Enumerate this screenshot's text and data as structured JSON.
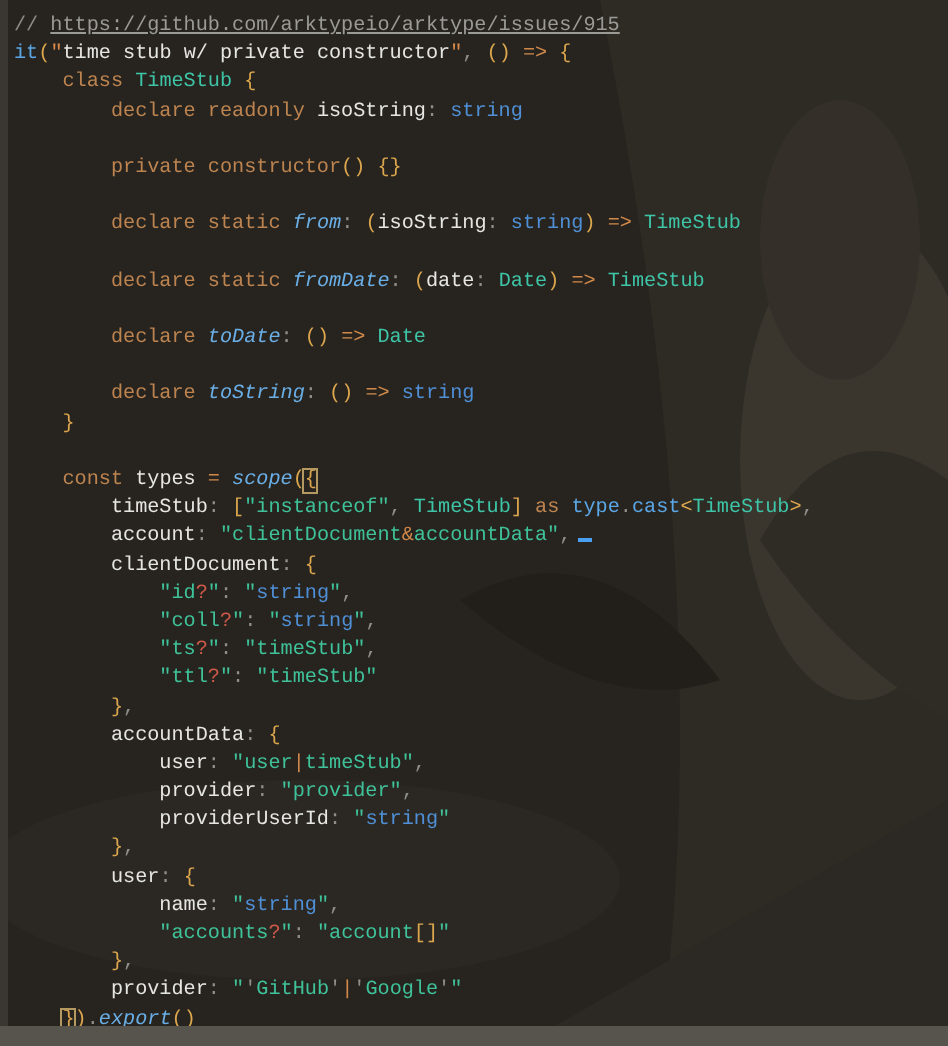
{
  "editor": {
    "lines": [
      {
        "tokens": [
          {
            "kind": "cm",
            "text": "// "
          },
          {
            "kind": "ln",
            "text": "https://github.com/arktypeio/arktype/issues/915"
          }
        ]
      },
      {
        "tokens": [
          {
            "kind": "call",
            "text": "it"
          },
          {
            "kind": "br",
            "text": "("
          },
          {
            "kind": "q",
            "text": "\""
          },
          {
            "kind": "id",
            "text": "time stub w/ private constructor"
          },
          {
            "kind": "q",
            "text": "\""
          },
          {
            "kind": "pu",
            "text": ", "
          },
          {
            "kind": "br",
            "text": "()"
          },
          {
            "kind": "op",
            "text": " => "
          },
          {
            "kind": "br",
            "text": "{"
          }
        ]
      },
      {
        "tokens": [
          {
            "kind": "kw",
            "text": "    class "
          },
          {
            "kind": "ty",
            "text": "TimeStub"
          },
          {
            "kind": "br",
            "text": " {"
          }
        ]
      },
      {
        "tokens": [
          {
            "kind": "kw",
            "text": "        declare readonly "
          },
          {
            "kind": "id",
            "text": "isoString"
          },
          {
            "kind": "pu",
            "text": ": "
          },
          {
            "kind": "bt",
            "text": "string"
          }
        ]
      },
      {
        "gap_before": true,
        "tokens": [
          {
            "kind": "kw",
            "text": "        private constructor"
          },
          {
            "kind": "br",
            "text": "() {}"
          }
        ]
      },
      {
        "gap_before": true,
        "tokens": [
          {
            "kind": "kw",
            "text": "        declare static "
          },
          {
            "kind": "fn",
            "text": "from"
          },
          {
            "kind": "pu",
            "text": ": "
          },
          {
            "kind": "br",
            "text": "("
          },
          {
            "kind": "id",
            "text": "isoString"
          },
          {
            "kind": "pu",
            "text": ": "
          },
          {
            "kind": "bt",
            "text": "string"
          },
          {
            "kind": "br",
            "text": ")"
          },
          {
            "kind": "op",
            "text": " => "
          },
          {
            "kind": "ty",
            "text": "TimeStub"
          }
        ]
      },
      {
        "gap_before": true,
        "tokens": [
          {
            "kind": "kw",
            "text": "        declare static "
          },
          {
            "kind": "fn",
            "text": "fromDate"
          },
          {
            "kind": "pu",
            "text": ": "
          },
          {
            "kind": "br",
            "text": "("
          },
          {
            "kind": "id",
            "text": "date"
          },
          {
            "kind": "pu",
            "text": ": "
          },
          {
            "kind": "ty",
            "text": "Date"
          },
          {
            "kind": "br",
            "text": ")"
          },
          {
            "kind": "op",
            "text": " => "
          },
          {
            "kind": "ty",
            "text": "TimeStub"
          }
        ]
      },
      {
        "gap_before": true,
        "tokens": [
          {
            "kind": "kw",
            "text": "        declare "
          },
          {
            "kind": "fn",
            "text": "toDate"
          },
          {
            "kind": "pu",
            "text": ": "
          },
          {
            "kind": "br",
            "text": "()"
          },
          {
            "kind": "op",
            "text": " => "
          },
          {
            "kind": "ty",
            "text": "Date"
          }
        ]
      },
      {
        "gap_before": true,
        "tokens": [
          {
            "kind": "kw",
            "text": "        declare "
          },
          {
            "kind": "fn",
            "text": "toString"
          },
          {
            "kind": "pu",
            "text": ": "
          },
          {
            "kind": "br",
            "text": "()"
          },
          {
            "kind": "op",
            "text": " => "
          },
          {
            "kind": "bt",
            "text": "string"
          }
        ]
      },
      {
        "tokens": [
          {
            "kind": "br",
            "text": "    }"
          }
        ]
      },
      {
        "gap_before": true,
        "tokens": [
          {
            "kind": "kw",
            "text": "    const "
          },
          {
            "kind": "id",
            "text": "types"
          },
          {
            "kind": "op",
            "text": " = "
          },
          {
            "kind": "fn",
            "text": "scope"
          },
          {
            "kind": "br",
            "text": "("
          },
          {
            "kind": "bm",
            "text": "{"
          }
        ]
      },
      {
        "tokens": [
          {
            "kind": "id",
            "text": "        timeStub"
          },
          {
            "kind": "pu",
            "text": ": "
          },
          {
            "kind": "br",
            "text": "["
          },
          {
            "kind": "st",
            "text": "\"instanceof\""
          },
          {
            "kind": "pu",
            "text": ", "
          },
          {
            "kind": "ty",
            "text": "TimeStub"
          },
          {
            "kind": "br",
            "text": "]"
          },
          {
            "kind": "kw",
            "text": " as "
          },
          {
            "kind": "call",
            "text": "type"
          },
          {
            "kind": "pu",
            "text": "."
          },
          {
            "kind": "call",
            "text": "cast"
          },
          {
            "kind": "br",
            "text": "<"
          },
          {
            "kind": "ty",
            "text": "TimeStub"
          },
          {
            "kind": "br",
            "text": ">"
          },
          {
            "kind": "pu",
            "text": ","
          }
        ]
      },
      {
        "cursor": true,
        "tokens": [
          {
            "kind": "id",
            "text": "        account"
          },
          {
            "kind": "pu",
            "text": ": "
          },
          {
            "kind": "st",
            "text": "\"clientDocument"
          },
          {
            "kind": "op",
            "text": "&"
          },
          {
            "kind": "st",
            "text": "accountData\""
          },
          {
            "kind": "pu",
            "text": ","
          }
        ]
      },
      {
        "tokens": [
          {
            "kind": "id",
            "text": "        clientDocument"
          },
          {
            "kind": "pu",
            "text": ": "
          },
          {
            "kind": "br",
            "text": "{"
          }
        ]
      },
      {
        "tokens": [
          {
            "kind": "st",
            "text": "            \"id"
          },
          {
            "kind": "re",
            "text": "?"
          },
          {
            "kind": "st",
            "text": "\""
          },
          {
            "kind": "pu",
            "text": ": "
          },
          {
            "kind": "st",
            "text": "\""
          },
          {
            "kind": "bt",
            "text": "string"
          },
          {
            "kind": "st",
            "text": "\""
          },
          {
            "kind": "pu",
            "text": ","
          }
        ]
      },
      {
        "tokens": [
          {
            "kind": "st",
            "text": "            \"coll"
          },
          {
            "kind": "re",
            "text": "?"
          },
          {
            "kind": "st",
            "text": "\""
          },
          {
            "kind": "pu",
            "text": ": "
          },
          {
            "kind": "st",
            "text": "\""
          },
          {
            "kind": "bt",
            "text": "string"
          },
          {
            "kind": "st",
            "text": "\""
          },
          {
            "kind": "pu",
            "text": ","
          }
        ]
      },
      {
        "tokens": [
          {
            "kind": "st",
            "text": "            \"ts"
          },
          {
            "kind": "re",
            "text": "?"
          },
          {
            "kind": "st",
            "text": "\""
          },
          {
            "kind": "pu",
            "text": ": "
          },
          {
            "kind": "st",
            "text": "\"timeStub\""
          },
          {
            "kind": "pu",
            "text": ","
          }
        ]
      },
      {
        "tokens": [
          {
            "kind": "st",
            "text": "            \"ttl"
          },
          {
            "kind": "re",
            "text": "?"
          },
          {
            "kind": "st",
            "text": "\""
          },
          {
            "kind": "pu",
            "text": ": "
          },
          {
            "kind": "st",
            "text": "\"timeStub\""
          }
        ]
      },
      {
        "tokens": [
          {
            "kind": "br",
            "text": "        }"
          },
          {
            "kind": "pu",
            "text": ","
          }
        ]
      },
      {
        "tokens": [
          {
            "kind": "id",
            "text": "        accountData"
          },
          {
            "kind": "pu",
            "text": ": "
          },
          {
            "kind": "br",
            "text": "{"
          }
        ]
      },
      {
        "tokens": [
          {
            "kind": "id",
            "text": "            user"
          },
          {
            "kind": "pu",
            "text": ": "
          },
          {
            "kind": "st",
            "text": "\"user"
          },
          {
            "kind": "op",
            "text": "|"
          },
          {
            "kind": "st",
            "text": "timeStub\""
          },
          {
            "kind": "pu",
            "text": ","
          }
        ]
      },
      {
        "tokens": [
          {
            "kind": "id",
            "text": "            provider"
          },
          {
            "kind": "pu",
            "text": ": "
          },
          {
            "kind": "st",
            "text": "\"provider\""
          },
          {
            "kind": "pu",
            "text": ","
          }
        ]
      },
      {
        "tokens": [
          {
            "kind": "id",
            "text": "            providerUserId"
          },
          {
            "kind": "pu",
            "text": ": "
          },
          {
            "kind": "st",
            "text": "\""
          },
          {
            "kind": "bt",
            "text": "string"
          },
          {
            "kind": "st",
            "text": "\""
          }
        ]
      },
      {
        "tokens": [
          {
            "kind": "br",
            "text": "        }"
          },
          {
            "kind": "pu",
            "text": ","
          }
        ]
      },
      {
        "tokens": [
          {
            "kind": "id",
            "text": "        user"
          },
          {
            "kind": "pu",
            "text": ": "
          },
          {
            "kind": "br",
            "text": "{"
          }
        ]
      },
      {
        "tokens": [
          {
            "kind": "id",
            "text": "            name"
          },
          {
            "kind": "pu",
            "text": ": "
          },
          {
            "kind": "st",
            "text": "\""
          },
          {
            "kind": "bt",
            "text": "string"
          },
          {
            "kind": "st",
            "text": "\""
          },
          {
            "kind": "pu",
            "text": ","
          }
        ]
      },
      {
        "tokens": [
          {
            "kind": "st",
            "text": "            \"accounts"
          },
          {
            "kind": "re",
            "text": "?"
          },
          {
            "kind": "st",
            "text": "\""
          },
          {
            "kind": "pu",
            "text": ": "
          },
          {
            "kind": "st",
            "text": "\"account"
          },
          {
            "kind": "br",
            "text": "[]"
          },
          {
            "kind": "st",
            "text": "\""
          }
        ]
      },
      {
        "tokens": [
          {
            "kind": "br",
            "text": "        }"
          },
          {
            "kind": "pu",
            "text": ","
          }
        ]
      },
      {
        "tokens": [
          {
            "kind": "id",
            "text": "        provider"
          },
          {
            "kind": "pu",
            "text": ": "
          },
          {
            "kind": "st",
            "text": "\""
          },
          {
            "kind": "pu",
            "text": "'"
          },
          {
            "kind": "st",
            "text": "GitHub"
          },
          {
            "kind": "pu",
            "text": "'"
          },
          {
            "kind": "op",
            "text": "|"
          },
          {
            "kind": "pu",
            "text": "'"
          },
          {
            "kind": "st",
            "text": "Google"
          },
          {
            "kind": "pu",
            "text": "'"
          },
          {
            "kind": "st",
            "text": "\""
          }
        ]
      },
      {
        "tokens": [
          {
            "kind": "bm",
            "text": "    }"
          },
          {
            "kind": "br",
            "text": ")"
          },
          {
            "kind": "pu",
            "text": "."
          },
          {
            "kind": "fn",
            "text": "export"
          },
          {
            "kind": "br",
            "text": "()"
          }
        ]
      }
    ]
  }
}
